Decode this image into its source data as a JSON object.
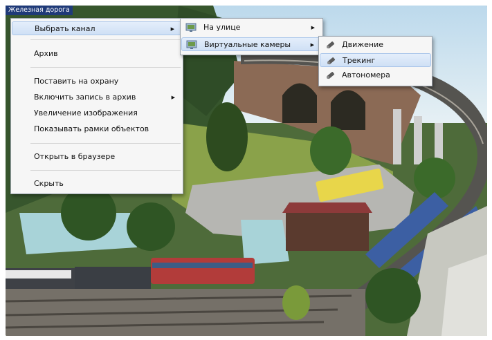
{
  "camera": {
    "title": "Железная дорога"
  },
  "context_menu": {
    "items": [
      {
        "label": "Выбрать канал"
      },
      {
        "label": "Архив"
      },
      {
        "label": "Поставить на охрану"
      },
      {
        "label": "Включить запись в архив"
      },
      {
        "label": "Увеличение изображения"
      },
      {
        "label": "Показывать рамки объектов"
      },
      {
        "label": "Открыть в браузере"
      },
      {
        "label": "Скрыть"
      }
    ]
  },
  "channel_menu": {
    "items": [
      {
        "label": "На улице",
        "icon": "camera-icon"
      },
      {
        "label": "Виртуальные камеры",
        "icon": "camera-icon"
      }
    ]
  },
  "virtual_menu": {
    "items": [
      {
        "label": "Движение",
        "icon": "detector-icon"
      },
      {
        "label": "Трекинг",
        "icon": "detector-icon"
      },
      {
        "label": "Автономера",
        "icon": "detector-icon"
      }
    ]
  },
  "colors": {
    "title_bg": "#1f3a78",
    "menu_bg": "#f6f6f6",
    "highlight": "#cfe0f5"
  }
}
